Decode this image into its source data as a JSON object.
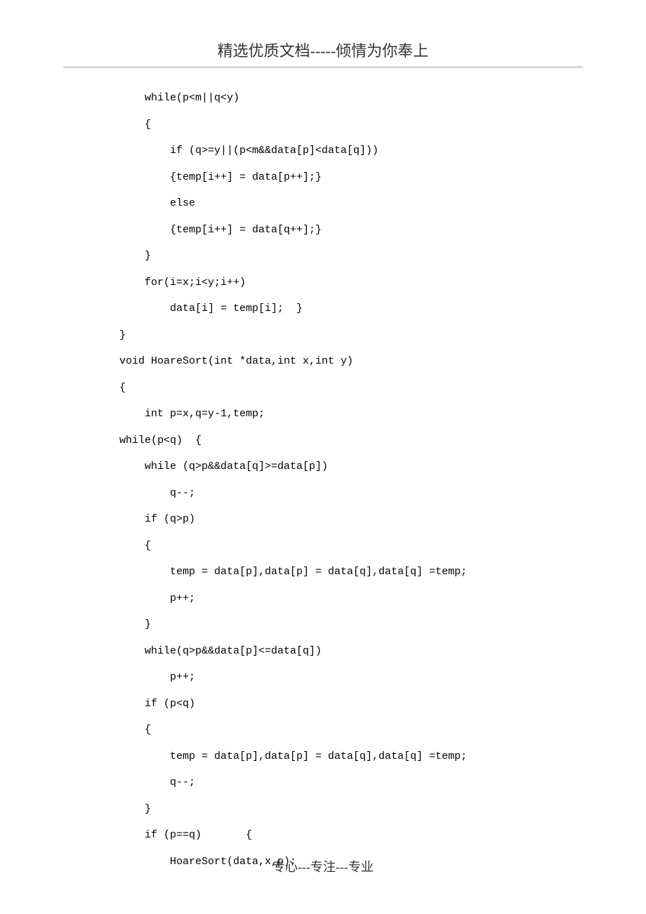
{
  "header": "精选优质文档-----倾情为你奉上",
  "footer": "专心---专注---专业",
  "code_lines": [
    "    while(p<m||q<y)",
    "    {",
    "        if (q>=y||(p<m&&data[p]<data[q]))",
    "        {temp[i++] = data[p++];}",
    "        else",
    "        {temp[i++] = data[q++];}",
    "    }",
    "    for(i=x;i<y;i++)",
    "        data[i] = temp[i];  }",
    "}",
    "void HoareSort(int *data,int x,int y)",
    "{",
    "    int p=x,q=y-1,temp;",
    "while(p<q)  {",
    "    while (q>p&&data[q]>=data[p])",
    "        q--;",
    "    if (q>p)",
    "    {",
    "        temp = data[p],data[p] = data[q],data[q] =temp;",
    "        p++;",
    "    }",
    "    while(q>p&&data[p]<=data[q])",
    "        p++;",
    "    if (p<q)",
    "    {",
    "        temp = data[p],data[p] = data[q],data[q] =temp;",
    "        q--;",
    "    }",
    "    if (p==q)       {",
    "        HoareSort(data,x,p);"
  ]
}
